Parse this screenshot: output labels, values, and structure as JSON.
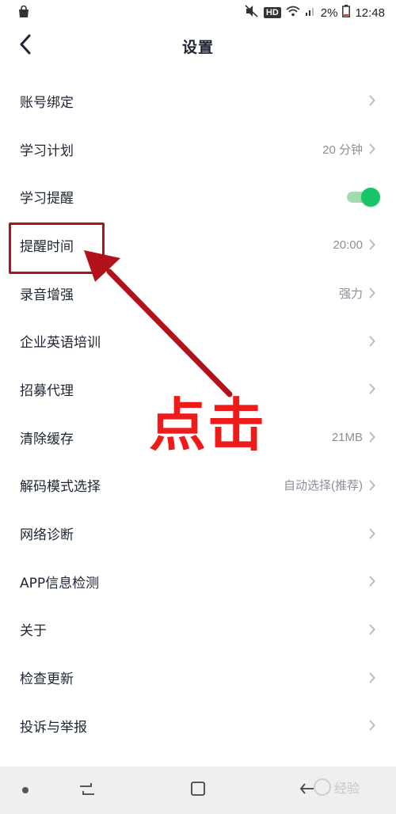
{
  "status_bar": {
    "battery_percent": "2%",
    "time": "12:48",
    "hd_badge": "HD"
  },
  "header": {
    "title": "设置"
  },
  "settings": [
    {
      "label": "账号绑定",
      "value": "",
      "control": "chevron"
    },
    {
      "label": "学习计划",
      "value": "20 分钟",
      "control": "chevron"
    },
    {
      "label": "学习提醒",
      "value": "",
      "control": "toggle",
      "toggle_on": true
    },
    {
      "label": "提醒时间",
      "value": "20:00",
      "control": "chevron"
    },
    {
      "label": "录音增强",
      "value": "强力",
      "control": "chevron"
    },
    {
      "label": "企业英语培训",
      "value": "",
      "control": "chevron"
    },
    {
      "label": "招募代理",
      "value": "",
      "control": "chevron"
    },
    {
      "label": "清除缓存",
      "value": "21MB",
      "control": "chevron"
    },
    {
      "label": "解码模式选择",
      "value": "自动选择(推荐)",
      "control": "chevron"
    },
    {
      "label": "网络诊断",
      "value": "",
      "control": "chevron"
    },
    {
      "label": "APP信息检测",
      "value": "",
      "control": "chevron"
    },
    {
      "label": "关于",
      "value": "",
      "control": "chevron"
    },
    {
      "label": "检查更新",
      "value": "",
      "control": "chevron"
    },
    {
      "label": "投诉与举报",
      "value": "",
      "control": "chevron"
    }
  ],
  "annotation": {
    "text": "点击",
    "color": "#ee1b1b",
    "box_color": "#b3121a"
  },
  "watermark": {
    "text": "经验"
  },
  "colors": {
    "toggle_on": "#18c46a",
    "toggle_track": "#9fdcb0",
    "value_text": "#8b8f98",
    "chevron": "#b9bcc2"
  }
}
